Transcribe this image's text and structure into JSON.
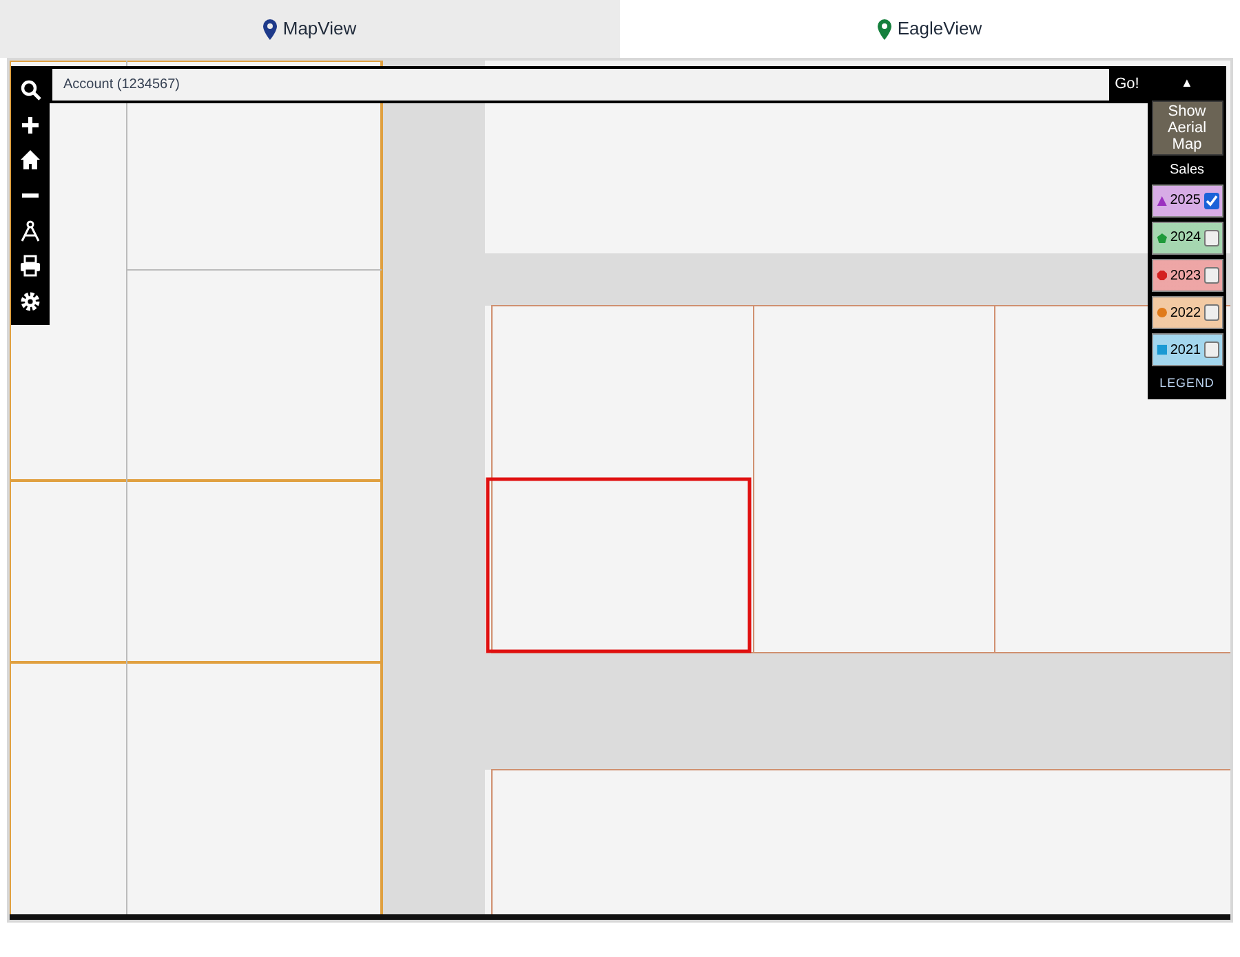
{
  "tabs": [
    {
      "label": "MapView",
      "selected": true,
      "color": "#1e3a8a"
    },
    {
      "label": "EagleView",
      "selected": false,
      "color": "#15803d"
    }
  ],
  "search": {
    "placeholder": "Account (1234567)",
    "button": "Go!"
  },
  "side_panel": {
    "collapse": "▲",
    "aerial_button": "Show Aerial Map",
    "heading": "Sales",
    "years": [
      {
        "label": "2025",
        "kind": "triangle",
        "color": "#9b30c0",
        "checked": true
      },
      {
        "label": "2024",
        "kind": "pentagon",
        "color": "#1f9a3a",
        "checked": false
      },
      {
        "label": "2023",
        "kind": "octagon",
        "color": "#d42020",
        "checked": false
      },
      {
        "label": "2022",
        "kind": "circle",
        "color": "#e07a1a",
        "checked": false
      },
      {
        "label": "2021",
        "kind": "square",
        "color": "#1a9ad4",
        "checked": false
      }
    ],
    "legend_button": "LEGEND"
  }
}
